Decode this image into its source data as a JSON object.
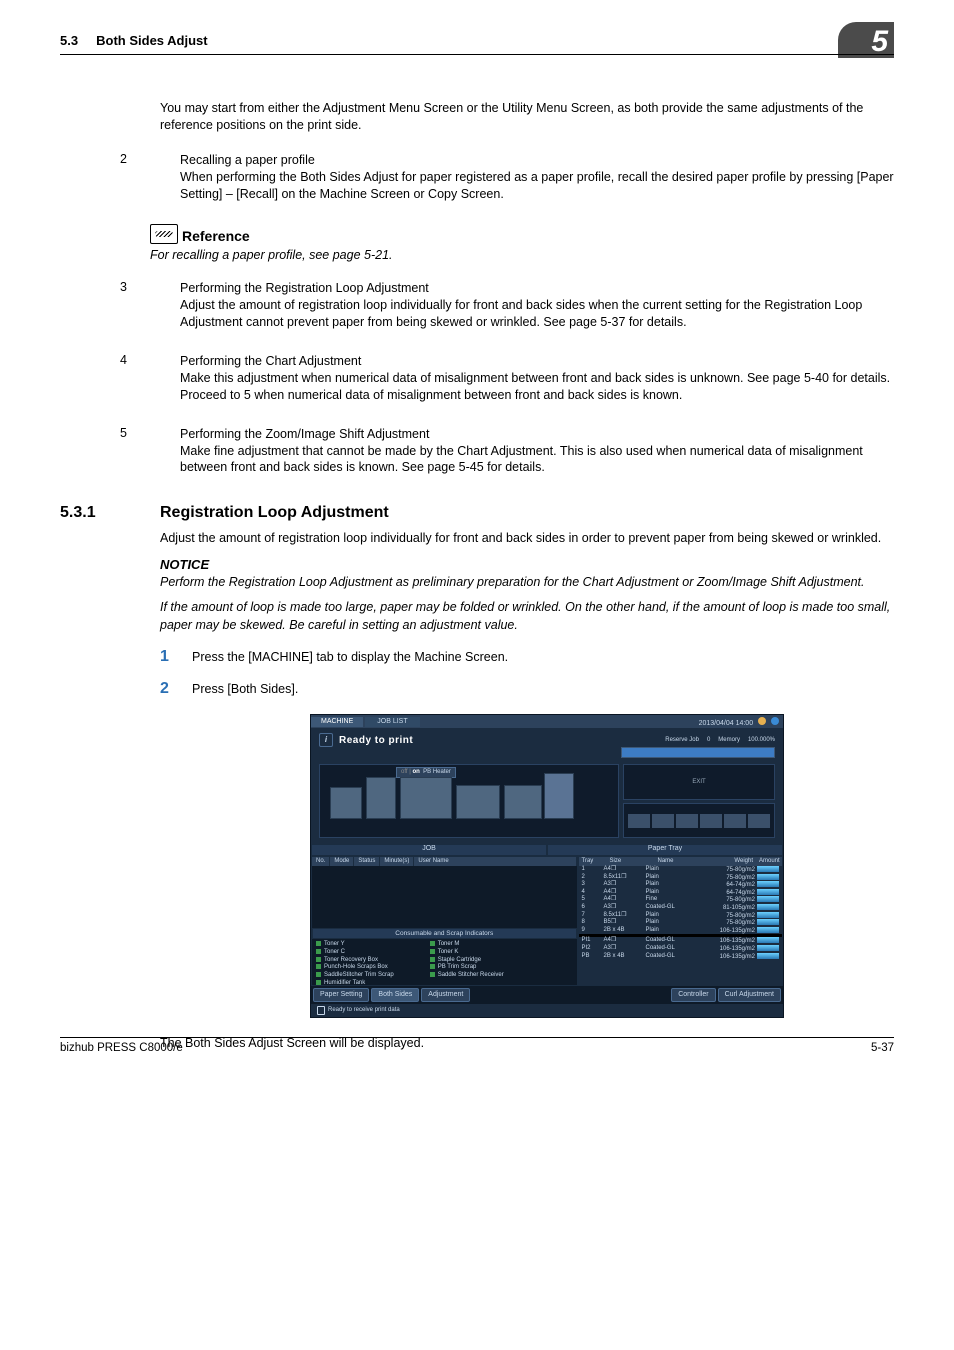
{
  "header": {
    "section_no": "5.3",
    "section_title": "Both Sides Adjust",
    "chapter_badge": "5"
  },
  "intro": "You may start from either the Adjustment Menu Screen or the Utility Menu Screen, as both provide the same adjustments of the reference positions on the print side.",
  "items": {
    "i2_num": "2",
    "i2_title": "Recalling a paper profile",
    "i2_body": "When performing the Both Sides Adjust for paper registered as a paper profile, recall the desired paper profile by pressing [Paper Setting] – [Recall] on the Machine Screen or Copy Screen.",
    "i3_num": "3",
    "i3_title": "Performing the Registration Loop Adjustment",
    "i3_body": "Adjust the amount of registration loop individually for front and back sides when the current setting for the Registration Loop Adjustment cannot prevent paper from being skewed or wrinkled. See page 5-37 for details.",
    "i4_num": "4",
    "i4_title": "Performing the Chart Adjustment",
    "i4_body1": "Make this adjustment when numerical data of misalignment between front and back sides is unknown. See page 5-40 for details.",
    "i4_body2": "Proceed to 5 when numerical data of misalignment between front and back sides is known.",
    "i5_num": "5",
    "i5_title": "Performing the Zoom/Image Shift Adjustment",
    "i5_body": "Make fine adjustment that cannot be made by the Chart Adjustment. This is also used when numerical data of misalignment between front and back sides is known. See page 5-45 for details."
  },
  "reference": {
    "title": "Reference",
    "body": "For recalling a paper profile, see page 5-21."
  },
  "sect": {
    "num": "5.3.1",
    "title": "Registration Loop Adjustment",
    "body1": "Adjust the amount of registration loop individually for front and back sides in order to prevent paper from being skewed or wrinkled.",
    "notice_label": "NOTICE",
    "notice1": "Perform the Registration Loop Adjustment as preliminary preparation for the Chart Adjustment or Zoom/Image Shift Adjustment.",
    "notice2": "If the amount of loop is made too large, paper may be folded or wrinkled. On the other hand, if the amount of loop is made too small, paper may be skewed. Be careful in setting an adjustment value.",
    "step1_num": "1",
    "step1": "Press the [MACHINE] tab to display the Machine Screen.",
    "step2_num": "2",
    "step2": "Press [Both Sides].",
    "after": "The Both Sides Adjust Screen will be displayed."
  },
  "screen": {
    "tab1": "MACHINE",
    "tab2": "JOB LIST",
    "clock": "2013/04/04 14:00",
    "ready": "Ready to print",
    "reserve": "Reserve Job",
    "reserve_val": "0",
    "memory": "Memory",
    "memory_val": "100.000%",
    "pbheater": "PB Heater",
    "sub_job": "JOB",
    "sub_tray": "Paper Tray",
    "jobcols": [
      "No.",
      "Mode",
      "Status",
      "Minute(s)",
      "User Name"
    ],
    "traycols": [
      "Tray",
      "Size",
      "Name",
      "Weight",
      "Amount"
    ],
    "trays": [
      {
        "n": "1",
        "s": "A4❐",
        "m": "Plain",
        "w": "75-80g/m2"
      },
      {
        "n": "2",
        "s": "8.5x11❐",
        "m": "Plain",
        "w": "75-80g/m2"
      },
      {
        "n": "3",
        "s": "A3❐",
        "m": "Plain",
        "w": "64-74g/m2"
      },
      {
        "n": "4",
        "s": "A4❐",
        "m": "Plain",
        "w": "64-74g/m2"
      },
      {
        "n": "5",
        "s": "A4❐",
        "m": "Fine",
        "w": "75-80g/m2"
      },
      {
        "n": "6",
        "s": "A3❐",
        "m": "Coated-GL",
        "w": "81-105g/m2"
      },
      {
        "n": "7",
        "s": "8.5x11❐",
        "m": "Plain",
        "w": "75-80g/m2"
      },
      {
        "n": "8",
        "s": "B5❐",
        "m": "Plain",
        "w": "75-80g/m2"
      },
      {
        "n": "9",
        "s": "2B x 4B",
        "m": "Plain",
        "w": "106-135g/m2"
      }
    ],
    "pi": [
      {
        "n": "PI1",
        "s": "A4❐",
        "m": "Coated-GL",
        "w": "106-135g/m2"
      },
      {
        "n": "PI2",
        "s": "A3❐",
        "m": "Coated-GL",
        "w": "106-135g/m2"
      },
      {
        "n": "PB",
        "s": "2B x 4B",
        "m": "Coated-GL",
        "w": "106-135g/m2"
      }
    ],
    "consum_title": "Consumable and Scrap Indicators",
    "consum_left": [
      "Toner Y",
      "Toner C",
      "Toner Recovery Box",
      "Punch-Hole Scraps Box",
      "SaddleStitcher Trim Scrap",
      "Humidifier Tank"
    ],
    "consum_right": [
      "Toner M",
      "Toner K",
      "Staple Cartridge",
      "PB Trim Scrap",
      "Saddle Stitcher Receiver"
    ],
    "btn_paper": "Paper Setting",
    "btn_both": "Both Sides",
    "btn_adj": "Adjustment",
    "btn_ctrl": "Controller",
    "btn_curl": "Curl Adjustment",
    "status_line": "Ready to receive print data"
  },
  "footer": {
    "left": "bizhub PRESS C8000/e",
    "right": "5-37"
  }
}
